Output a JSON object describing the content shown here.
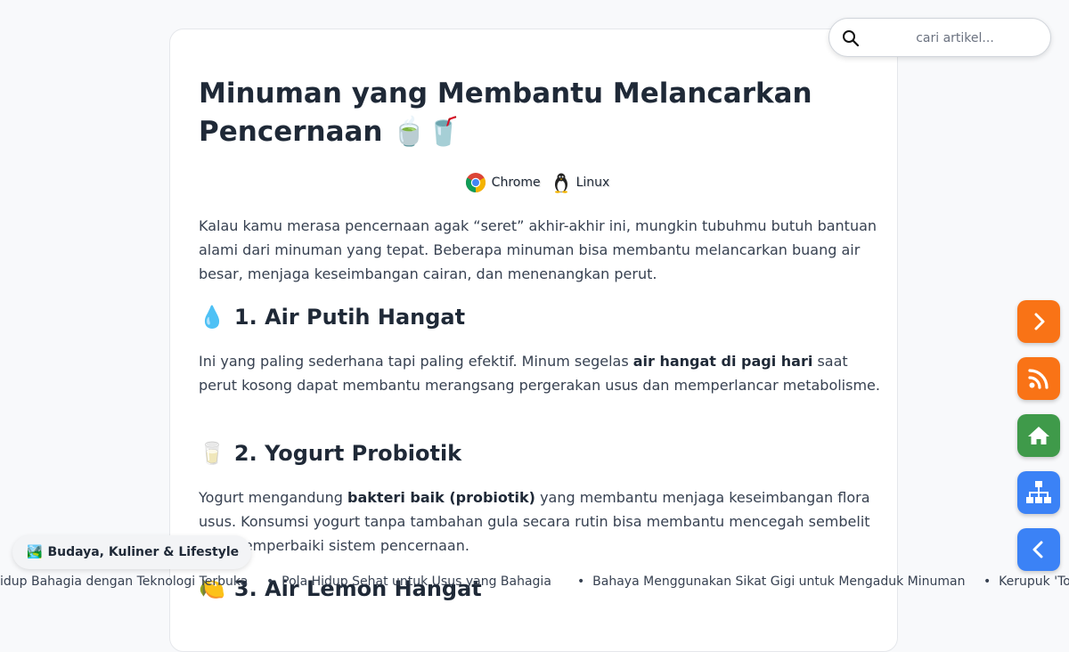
{
  "article": {
    "title": "Minuman yang Membantu Melancarkan Pencernaan 🍵🥤",
    "meta": [
      {
        "icon": "chrome-icon",
        "label": "Chrome"
      },
      {
        "icon": "linux-penguin-icon",
        "label": "Linux"
      }
    ],
    "intro": "Kalau kamu merasa pencernaan agak “seret” akhir-akhir ini, mungkin tubuhmu butuh bantuan alami dari minuman yang tepat. Beberapa minuman bisa membantu melancarkan buang air besar, menjaga keseimbangan cairan, dan menenangkan perut.",
    "sections": [
      {
        "icon": "💧",
        "heading": "1. Air Putih Hangat",
        "text_before": "Ini yang paling sederhana tapi paling efektif. Minum segelas ",
        "bold": "air hangat di pagi hari",
        "text_after": " saat perut kosong dapat membantu merangsang pergerakan usus dan memperlancar metabolisme."
      },
      {
        "icon": "🥛",
        "heading": "2. Yogurt Probiotik",
        "text_before": "Yogurt mengandung ",
        "bold": "bakteri baik (probiotik)",
        "text_after": " yang membantu menjaga keseimbangan flora usus. Konsumsi yogurt tanpa tambahan gula secara rutin bisa membantu mencegah sembelit dan memperbaiki sistem pencernaan."
      },
      {
        "icon": "🍋",
        "heading": "3. Air Lemon Hangat"
      }
    ]
  },
  "search": {
    "placeholder": "cari artikel..."
  },
  "category_badge": {
    "icon": "🏞️",
    "label": "Budaya, Kuliner & Lifestyle"
  },
  "ticker": [
    "idup Bahagia dengan Teknologi Terbuka",
    "Pola Hidup Sehat untuk Usus yang Bahagia",
    "Bahaya Menggunakan Sikat Gigi untuk Mengaduk Minuman",
    "Kerupuk 'Tol"
  ],
  "fab_buttons": [
    {
      "name": "next-button",
      "icon": "chevron-right-icon",
      "color": "#f97316"
    },
    {
      "name": "rss-button",
      "icon": "rss-icon",
      "color": "#f97316"
    },
    {
      "name": "home-button",
      "icon": "home-icon",
      "color": "#3f9a4a"
    },
    {
      "name": "sitemap-button",
      "icon": "sitemap-icon",
      "color": "#3b82f6"
    },
    {
      "name": "back-button",
      "icon": "chevron-left-icon",
      "color": "#3b82f6"
    }
  ]
}
